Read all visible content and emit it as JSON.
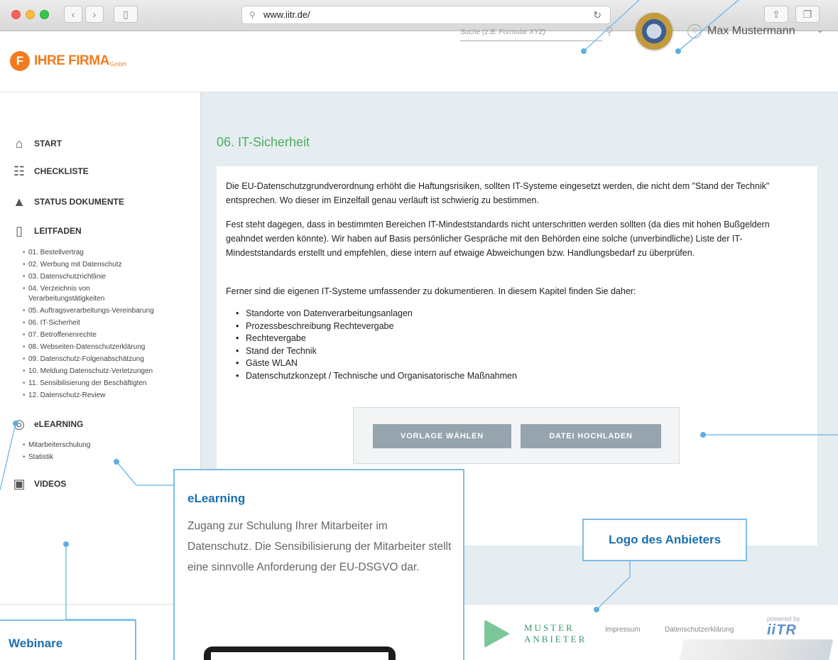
{
  "browser": {
    "url": "www.iitr.de/",
    "back_icon": "chevron-left-icon",
    "forward_icon": "chevron-right-icon"
  },
  "header": {
    "logo_initial": "F",
    "logo_text": "IHRE FIRMA",
    "logo_suffix": "GmbH",
    "search_placeholder": "Suche (z.B. Formular XYZ)",
    "user_name": "Max Mustermann"
  },
  "sidebar": {
    "items": [
      {
        "label": "START",
        "icon": "home-icon"
      },
      {
        "label": "CHECKLISTE",
        "icon": "checklist-icon"
      },
      {
        "label": "STATUS DOKUMENTE",
        "icon": "pyramid-icon"
      },
      {
        "label": "LEITFADEN",
        "icon": "book-icon"
      },
      {
        "label": "eLEARNING",
        "icon": "brain-icon"
      },
      {
        "label": "VIDEOS",
        "icon": "video-icon"
      }
    ],
    "leitfaden": [
      "01. Bestellvertrag",
      "02. Werbung mit Datenschutz",
      "03. Datenschutzrichtlinie",
      "04. Verzeichnis von",
      "Verarbeitungstätigkeiten",
      "05. Auftragsverarbeitungs-Vereinbarung",
      "06. IT-Sicherheit",
      "07. Betroffenenrechte",
      "08. Webseiten-Datenschutzerklärung",
      "09. Datenschutz-Folgenabschätzung",
      "10. Meldung Datenschutz-Verletzungen",
      "11. Sensibilisierung der Beschäftigten",
      "12. Datenschutz-Review"
    ],
    "elearning": [
      "Mitarbeiterschulung",
      "Statistik"
    ]
  },
  "main": {
    "title": "06. IT-Sicherheit",
    "p1": "Die EU-Datenschutzgrundverordnung erhöht die Haftungsrisiken, sollten IT-Systeme eingesetzt werden, die nicht dem \"Stand der Technik\" entsprechen. Wo dieser im Einzelfall genau verläuft ist schwierig zu bestimmen.",
    "p2": "Fest steht dagegen, dass in bestimmten Bereichen IT-Mindeststandards nicht unterschritten werden sollten (da dies mit hohen Bußgeldern geahndet werden könnte). Wir haben auf Basis persönlicher Gespräche mit den Behörden eine solche (unverbindliche) Liste der IT-Mindeststandards erstellt und empfehlen, diese intern auf etwaige Abweichungen bzw. Handlungsbedarf zu überprüfen.",
    "p3": "Ferner sind die eigenen IT-Systeme umfassender zu dokumentieren. In diesem Kapitel finden Sie daher:",
    "list": [
      "Standorte von Datenverarbeitungsanlagen",
      "Prozessbeschreibung Rechtevergabe",
      "Rechtevergabe",
      "Stand der Technik",
      "Gäste WLAN",
      "Datenschutzkonzept / Technische und Organisatorische Maßnahmen"
    ],
    "btn_template": "VORLAGE WÄHLEN",
    "btn_upload": "DATEI HOCHLADEN"
  },
  "footer": {
    "provider_line1": "MUSTER",
    "provider_line2": "ANBIETER",
    "impressum": "Impressum",
    "datenschutz": "Datenschutzerklärung",
    "powered": "powered by",
    "itr_logo": "iiTR"
  },
  "annotations": {
    "elearning_title": "eLearning",
    "elearning_text": "Zugang zur Schulung Ihrer Mitarbeiter im Datenschutz. Die Sensibilisierung der Mitarbeiter stellt eine sinnvolle Anforderung der EU-DSGVO dar.",
    "logo_title": "Logo des Anbieters",
    "webinar_title": "Webinare"
  },
  "colors": {
    "accent_orange": "#f07c1e",
    "title_green": "#4cae63",
    "button_gray": "#95a4ad",
    "callout_blue": "#7bbde8",
    "callout_text": "#1a6fb0"
  }
}
